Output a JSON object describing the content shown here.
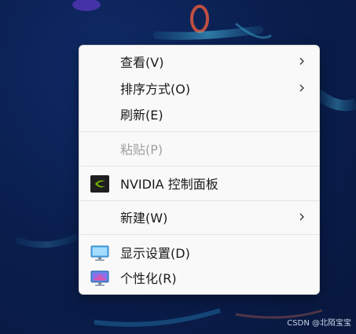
{
  "menu": {
    "items": [
      {
        "label": "查看(V)",
        "has_submenu": true
      },
      {
        "label": "排序方式(O)",
        "has_submenu": true
      },
      {
        "label": "刷新(E)",
        "has_submenu": false
      },
      {
        "label": "粘贴(P)",
        "has_submenu": false,
        "disabled": true
      },
      {
        "label": "NVIDIA 控制面板",
        "icon": "nvidia-icon"
      },
      {
        "label": "新建(W)",
        "has_submenu": true
      },
      {
        "label": "显示设置(D)",
        "icon": "display-settings-icon"
      },
      {
        "label": "个性化(R)",
        "icon": "personalize-icon"
      }
    ]
  },
  "watermark": "CSDN @北陌宝宝",
  "colors": {
    "menu_bg": "#f9f9f9",
    "disabled_text": "#a0a0a0",
    "nvidia_green": "#76b900",
    "desktop_bg": "#0a1f4f"
  }
}
